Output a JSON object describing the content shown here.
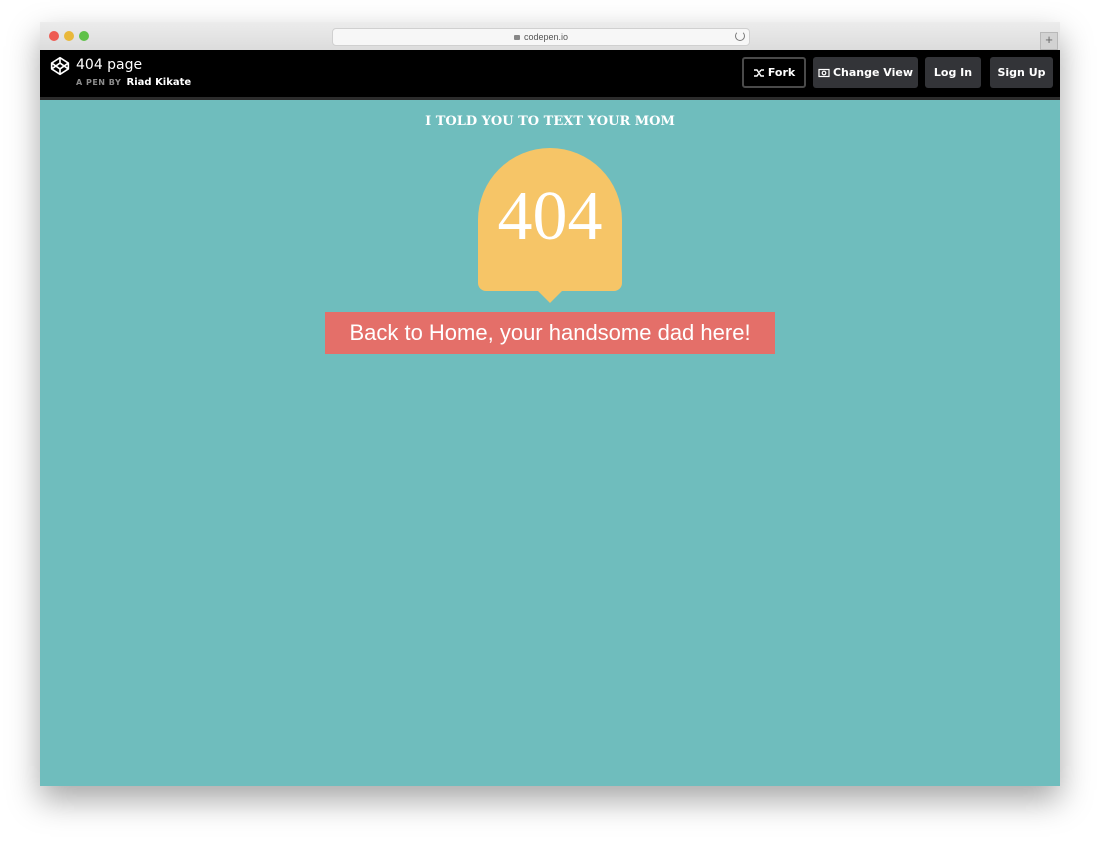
{
  "browser": {
    "url": "codepen.io",
    "newtab_label": "+"
  },
  "header": {
    "title": "404 page",
    "by_label": "A PEN BY",
    "author": "Riad Kikate",
    "buttons": {
      "fork": "Fork",
      "change_view": "Change View",
      "login": "Log In",
      "signup": "Sign Up"
    }
  },
  "content": {
    "tagline": "I TOLD YOU TO TEXT YOUR MOM",
    "error_code": "404",
    "home_button": "Back to Home, your handsome dad here!"
  },
  "colors": {
    "background": "#6fbdbd",
    "bubble": "#f6c567",
    "button": "#e46f69"
  },
  "icons": [
    "codepen-logo-icon",
    "fork-icon",
    "change-view-icon",
    "lock-icon",
    "reload-icon"
  ]
}
